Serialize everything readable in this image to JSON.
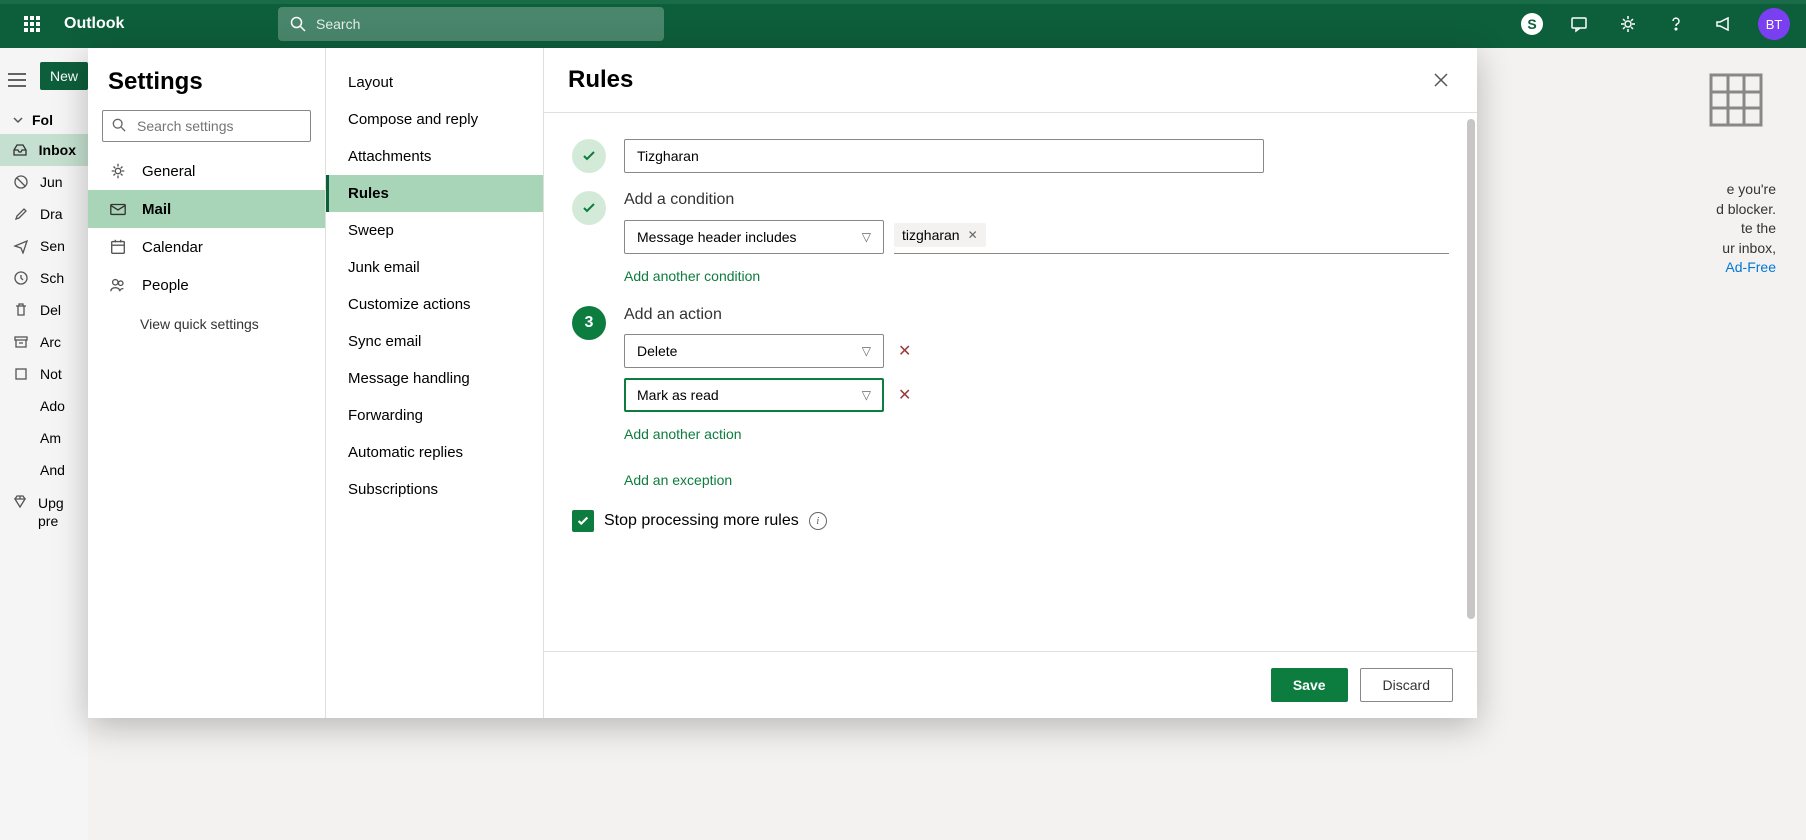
{
  "header": {
    "app_name": "Outlook",
    "search_placeholder": "Search",
    "avatar_initials": "BT",
    "skype_badge": "S"
  },
  "folders": {
    "new_button": "New",
    "header": "Fol",
    "items": [
      {
        "label": "Inbox",
        "active": true
      },
      {
        "label": "Jun"
      },
      {
        "label": "Dra"
      },
      {
        "label": "Sen"
      },
      {
        "label": "Sch"
      },
      {
        "label": "Del"
      },
      {
        "label": "Arc"
      },
      {
        "label": "Not"
      },
      {
        "label": "Ado"
      },
      {
        "label": "Am"
      },
      {
        "label": "And"
      }
    ],
    "upgrade_line1": "Upg",
    "upgrade_line2": "pre"
  },
  "bg": {
    "text1": "e you're",
    "text2": "d blocker.",
    "text3": "te the",
    "text4": "ur inbox,",
    "link": "Ad-Free"
  },
  "settings": {
    "title": "Settings",
    "search_placeholder": "Search settings",
    "view_quick": "View quick settings",
    "categories": [
      {
        "label": "General"
      },
      {
        "label": "Mail",
        "active": true
      },
      {
        "label": "Calendar"
      },
      {
        "label": "People"
      }
    ],
    "subcategories": [
      {
        "label": "Layout"
      },
      {
        "label": "Compose and reply"
      },
      {
        "label": "Attachments"
      },
      {
        "label": "Rules",
        "active": true
      },
      {
        "label": "Sweep"
      },
      {
        "label": "Junk email"
      },
      {
        "label": "Customize actions"
      },
      {
        "label": "Sync email"
      },
      {
        "label": "Message handling"
      },
      {
        "label": "Forwarding"
      },
      {
        "label": "Automatic replies"
      },
      {
        "label": "Subscriptions"
      }
    ]
  },
  "rules": {
    "title": "Rules",
    "rule_name": "Tizgharan",
    "step2_label": "Add a condition",
    "condition_select": "Message header includes",
    "condition_tag": "tizgharan",
    "add_condition": "Add another condition",
    "step3_num": "3",
    "step3_label": "Add an action",
    "action1": "Delete",
    "action2": "Mark as read",
    "add_action": "Add another action",
    "add_exception": "Add an exception",
    "stop_processing": "Stop processing more rules",
    "save": "Save",
    "discard": "Discard"
  }
}
